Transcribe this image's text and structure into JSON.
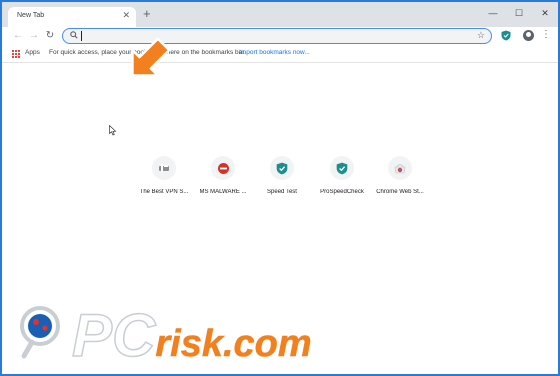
{
  "browser": {
    "tab_title": "New Tab",
    "tab_close": "✕",
    "new_tab": "+",
    "window": {
      "minimize": "—",
      "maximize": "☐",
      "close": "✕"
    }
  },
  "toolbar": {
    "back": "←",
    "forward": "→",
    "reload": "↻",
    "omnibox_value": "",
    "star": "☆",
    "menu": "⋮"
  },
  "bookmarks": {
    "apps_label": "Apps",
    "hint": "For quick access, place your bookmarks here on the bookmarks bar.",
    "import_link": "Import bookmarks now..."
  },
  "tiles": [
    {
      "label": "The Best VPN S...",
      "icon": "vpn-icon"
    },
    {
      "label": "MS MALWARE ...",
      "icon": "no-entry-icon"
    },
    {
      "label": "Speed Test",
      "icon": "shield-icon"
    },
    {
      "label": "ProSpeedCheck",
      "icon": "shield-icon"
    },
    {
      "label": "Chrome Web St...",
      "icon": "webstore-icon"
    }
  ],
  "watermark": {
    "text": "PCrisk.com"
  },
  "colors": {
    "frame": "#2a7ad8",
    "arrow": "#f2801e",
    "link": "#1a73e8",
    "shield": "#1c8f8c"
  }
}
